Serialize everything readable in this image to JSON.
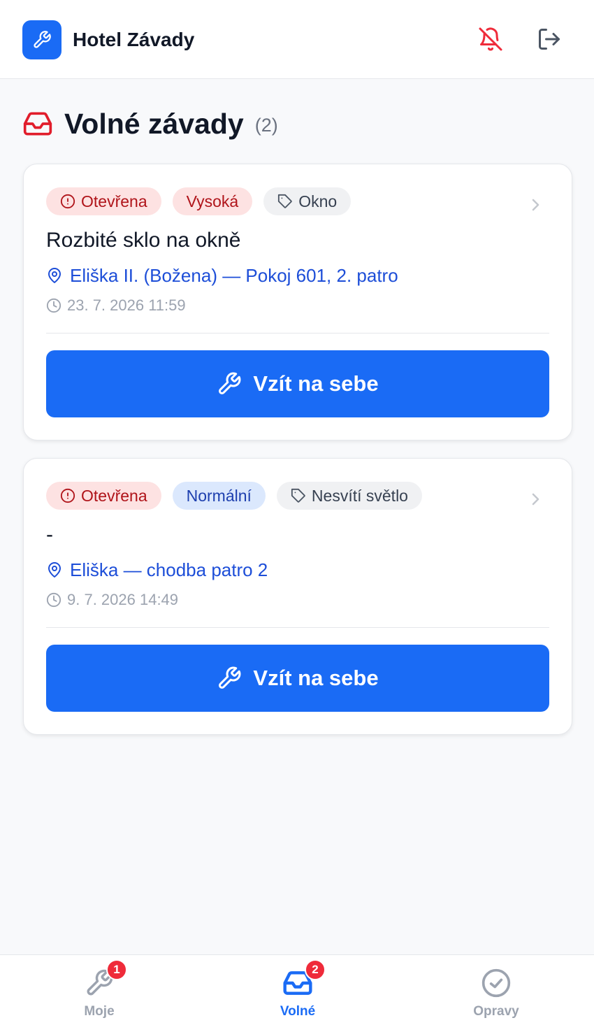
{
  "header": {
    "app_title": "Hotel Závady",
    "logo_icon": "wrench-icon",
    "bell_icon": "bell-off-icon",
    "logout_icon": "logout-icon",
    "accent_color": "#1a6bf5",
    "bell_color": "#ef2b3a"
  },
  "section": {
    "title": "Volné závady",
    "count": "(2)",
    "icon": "inbox-icon"
  },
  "cards": [
    {
      "status": "Otevřena",
      "priority": "Vysoká",
      "category": "Okno",
      "title": "Rozbité sklo na okně",
      "location": "Eliška II. (Božena) — Pokoj 601, 2. patro",
      "time": "23. 7. 2026 11:59",
      "button_label": "Vzít na sebe"
    },
    {
      "status": "Otevřena",
      "priority": "Normální",
      "category": "Nesvítí světlo",
      "title": "-",
      "location": "Eliška — chodba patro 2",
      "time": "9. 7. 2026 14:49",
      "button_label": "Vzít na sebe"
    }
  ],
  "bottom_nav": [
    {
      "label": "Moje",
      "icon": "wrench-icon",
      "badge": "1",
      "active": false
    },
    {
      "label": "Volné",
      "icon": "inbox-icon",
      "badge": "2",
      "active": true
    },
    {
      "label": "Opravy",
      "icon": "check-circle-icon",
      "active": false
    }
  ]
}
